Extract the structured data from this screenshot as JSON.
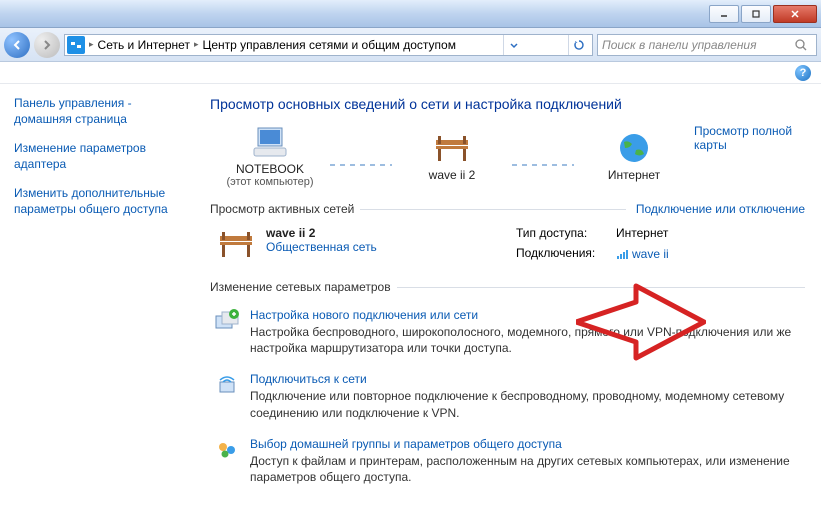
{
  "window": {
    "minimize": "_",
    "maximize": "□",
    "close": "×"
  },
  "navbar": {
    "crumb1": "Сеть и Интернет",
    "crumb2": "Центр управления сетями и общим доступом",
    "search_placeholder": "Поиск в панели управления"
  },
  "sidebar": {
    "link1": "Панель управления - домашняя страница",
    "link2": "Изменение параметров адаптера",
    "link3": "Изменить дополнительные параметры общего доступа"
  },
  "main": {
    "heading": "Просмотр основных сведений о сети и настройка подключений",
    "view_full_map": "Просмотр полной карты",
    "node_computer": "NOTEBOOK",
    "node_computer_sub": "(этот компьютер)",
    "node_network": "wave ii  2",
    "node_internet": "Интернет",
    "active_networks_header": "Просмотр активных сетей",
    "connect_disconnect": "Подключение или отключение",
    "active_net_name": "wave ii  2",
    "active_net_type": "Общественная сеть",
    "access_type_label": "Тип доступа:",
    "access_type_value": "Интернет",
    "connections_label": "Подключения:",
    "connections_value": "wave ii",
    "settings_header": "Изменение сетевых параметров",
    "set1_title": "Настройка нового подключения или сети",
    "set1_desc": "Настройка беспроводного, широкополосного, модемного, прямого или VPN-подключения или же настройка маршрутизатора или точки доступа.",
    "set2_title": "Подключиться к сети",
    "set2_desc": "Подключение или повторное подключение к беспроводному, проводному, модемному сетевому соединению или подключение к VPN.",
    "set3_title": "Выбор домашней группы и параметров общего доступа",
    "set3_desc": "Доступ к файлам и принтерам, расположенным на других сетевых компьютерах, или изменение параметров общего доступа."
  }
}
